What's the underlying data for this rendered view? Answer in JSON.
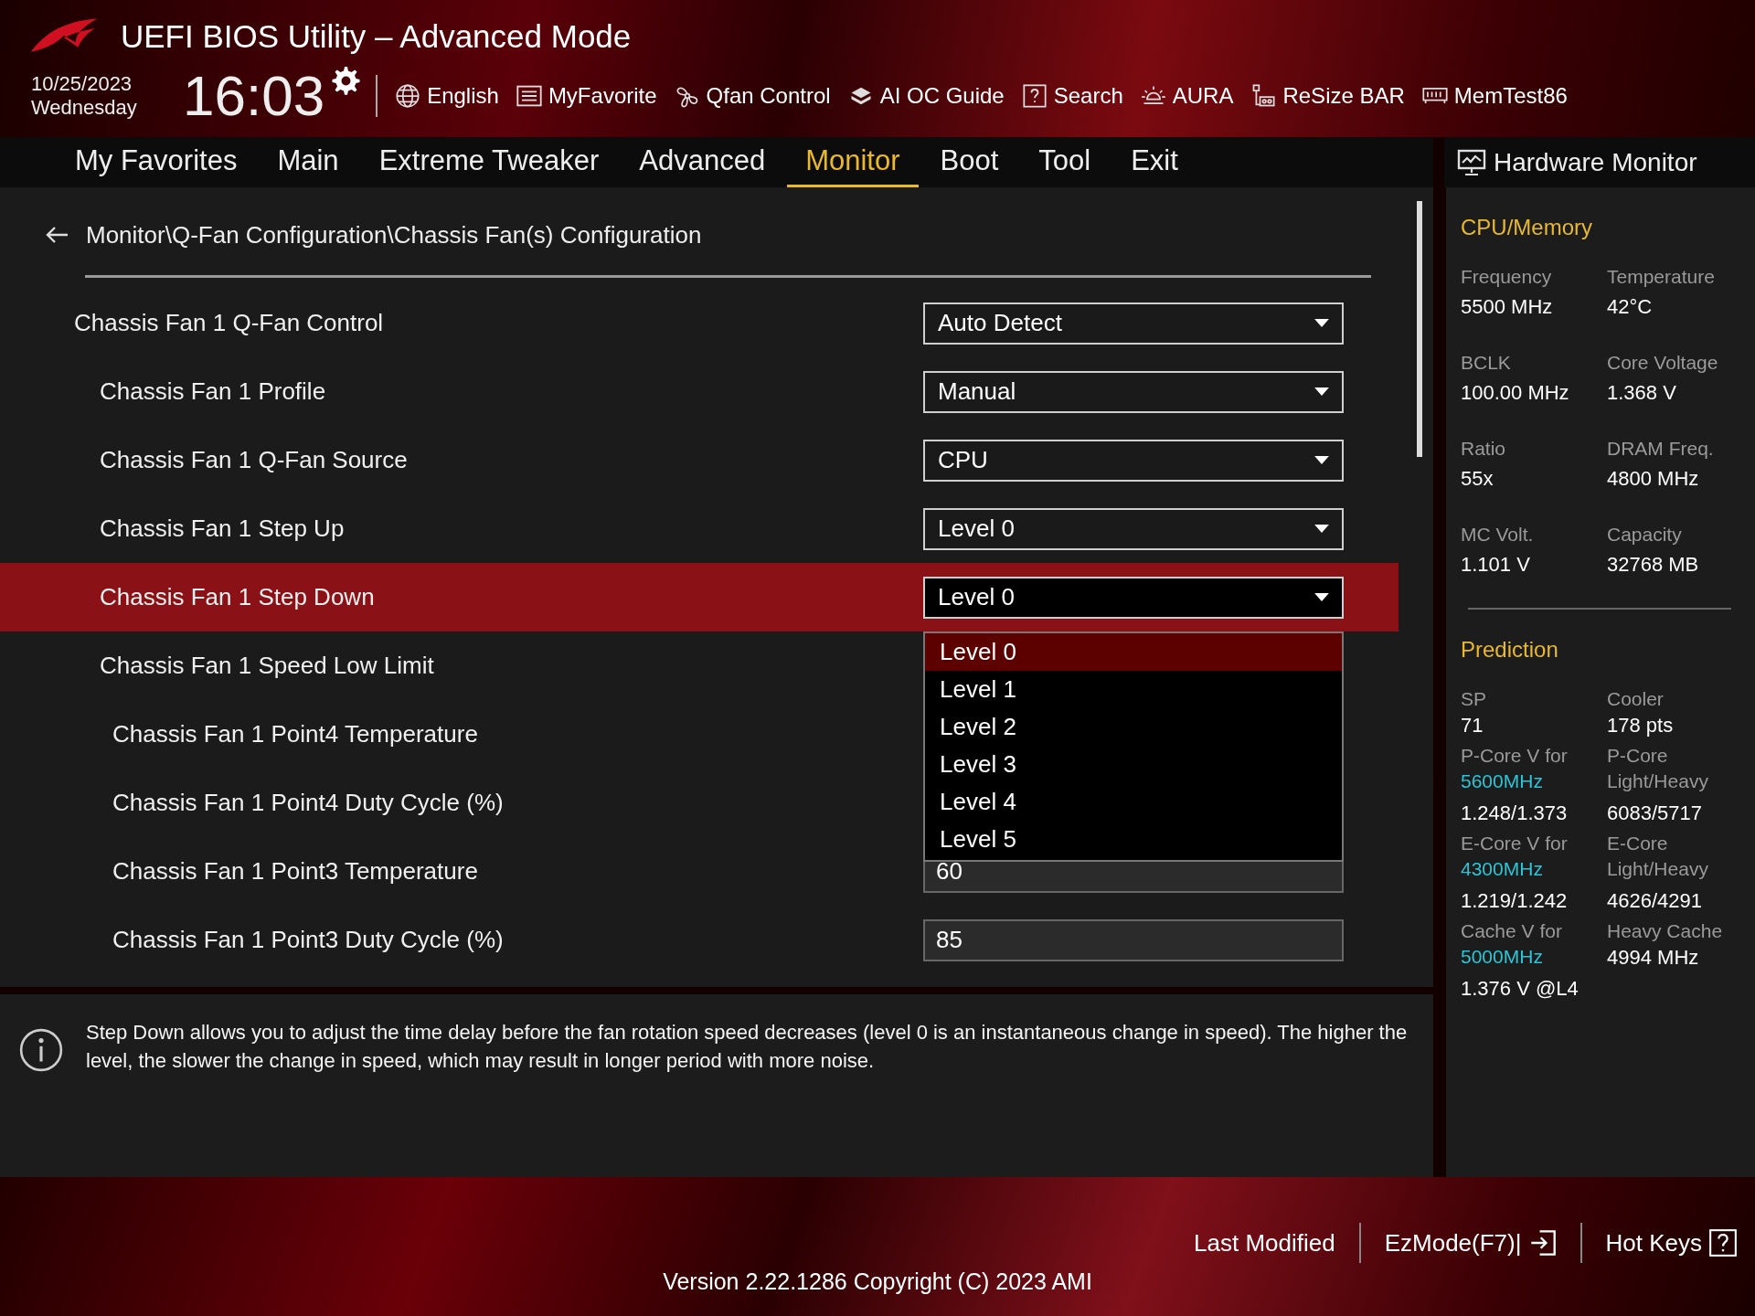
{
  "header": {
    "title": "UEFI BIOS Utility – Advanced Mode",
    "date": "10/25/2023",
    "weekday": "Wednesday",
    "time": "16:03",
    "toolbar": [
      {
        "kind": "globe",
        "label": "English"
      },
      {
        "kind": "favorite",
        "label": "MyFavorite"
      },
      {
        "kind": "fan",
        "label": "Qfan Control"
      },
      {
        "kind": "ai",
        "label": "AI OC Guide"
      },
      {
        "kind": "help",
        "label": "Search"
      },
      {
        "kind": "aura",
        "label": "AURA"
      },
      {
        "kind": "resize",
        "label": "ReSize BAR"
      },
      {
        "kind": "memory",
        "label": "MemTest86"
      }
    ]
  },
  "tabs": [
    {
      "label": "My Favorites",
      "selected": false
    },
    {
      "label": "Main",
      "selected": false
    },
    {
      "label": "Extreme Tweaker",
      "selected": false
    },
    {
      "label": "Advanced",
      "selected": false
    },
    {
      "label": "Monitor",
      "selected": true
    },
    {
      "label": "Boot",
      "selected": false
    },
    {
      "label": "Tool",
      "selected": false
    },
    {
      "label": "Exit",
      "selected": false
    }
  ],
  "breadcrumb": "Monitor\\Q-Fan Configuration\\Chassis Fan(s) Configuration",
  "settings": [
    {
      "label": "Chassis Fan 1 Q-Fan Control",
      "kind": "select",
      "value": "Auto Detect",
      "selected": false,
      "expanded": false,
      "children": [
        {
          "label": "Chassis Fan 1 Profile",
          "kind": "select",
          "value": "Manual",
          "selected": false,
          "expanded": false
        },
        {
          "label": "Chassis Fan 1 Q-Fan Source",
          "kind": "select",
          "value": "CPU",
          "selected": false,
          "expanded": false
        },
        {
          "label": "Chassis Fan 1 Step Up",
          "kind": "select",
          "value": "Level 0",
          "selected": false,
          "expanded": false
        },
        {
          "label": "Chassis Fan 1 Step Down",
          "kind": "select",
          "value": "Level 0",
          "selected": true,
          "expanded": true,
          "options": [
            {
              "label": "Level 0",
              "selected": true
            },
            {
              "label": "Level 1",
              "selected": false
            },
            {
              "label": "Level 2",
              "selected": false
            },
            {
              "label": "Level 3",
              "selected": false
            },
            {
              "label": "Level 4",
              "selected": false
            },
            {
              "label": "Level 5",
              "selected": false
            }
          ]
        },
        {
          "label": "Chassis Fan 1 Speed Low Limit",
          "kind": "hidden",
          "selected": false,
          "children": [
            {
              "label": "Chassis Fan 1 Point4 Temperature",
              "kind": "hidden",
              "selected": false
            },
            {
              "label": "Chassis Fan 1 Point4 Duty Cycle (%)",
              "kind": "hidden",
              "selected": false
            },
            {
              "label": "Chassis Fan 1 Point3 Temperature",
              "kind": "input",
              "value": "60",
              "selected": false
            },
            {
              "label": "Chassis Fan 1 Point3 Duty Cycle (%)",
              "kind": "input",
              "value": "85",
              "selected": false
            }
          ]
        }
      ]
    }
  ],
  "help": "Step Down allows you to adjust the time delay before the fan rotation speed decreases (level 0 is an instantaneous change in speed). The higher the level, the slower the change in speed, which may result in longer period with more noise.",
  "hardware_monitor": {
    "title": "Hardware Monitor",
    "sections": [
      {
        "title": "CPU/Memory",
        "cells": [
          {
            "label": "Frequency",
            "value": "5500 MHz"
          },
          {
            "label": "Temperature",
            "value": "42°C"
          },
          {
            "label": "BCLK",
            "value": "100.00 MHz"
          },
          {
            "label": "Core Voltage",
            "value": "1.368 V"
          },
          {
            "label": "Ratio",
            "value": "55x"
          },
          {
            "label": "DRAM Freq.",
            "value": "4800 MHz"
          },
          {
            "label": "MC Volt.",
            "value": "1.101 V"
          },
          {
            "label": "Capacity",
            "value": "32768 MB"
          }
        ]
      },
      {
        "title": "Prediction",
        "cells": [
          {
            "label": "SP",
            "value": "71"
          },
          {
            "label": "Cooler",
            "value": "178 pts"
          },
          {
            "label": "P-Core V for",
            "freq": "5600MHz",
            "value": "1.248/1.373"
          },
          {
            "label": "P-Core",
            "label_2": "Light/Heavy",
            "value": "6083/5717"
          },
          {
            "label": "E-Core V for",
            "freq": "4300MHz",
            "value": "1.219/1.242"
          },
          {
            "label": "E-Core",
            "label_2": "Light/Heavy",
            "value": "4626/4291"
          },
          {
            "label": "Cache V for",
            "freq": "5000MHz",
            "value": "1.376 V @L4"
          },
          {
            "label": "Heavy Cache",
            "value": "4994 MHz"
          }
        ]
      }
    ]
  },
  "footer": {
    "buttons": [
      {
        "kind": "plain",
        "label": "Last Modified"
      },
      {
        "kind": "exit",
        "label": "EzMode(F7)|"
      },
      {
        "kind": "help",
        "label": "Hot Keys"
      }
    ],
    "version": "Version 2.22.1286 Copyright (C) 2023 AMI"
  }
}
